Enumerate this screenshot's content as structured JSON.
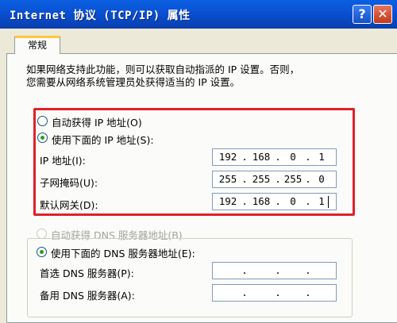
{
  "window": {
    "title": "Internet 协议 (TCP/IP) 属性",
    "help_glyph": "?",
    "close_glyph": "✕"
  },
  "tab": {
    "label": "常规"
  },
  "description": {
    "line1": "如果网络支持此功能，则可以获取自动指派的 IP 设置。否则，",
    "line2": "您需要从网络系统管理员处获得适当的 IP 设置。"
  },
  "ip_section": {
    "auto_option": "自动获得 IP 地址(O)",
    "manual_option": "使用下面的 IP 地址(S):",
    "selected": "manual",
    "fields": [
      {
        "label": "IP 地址(I):",
        "octets": [
          "192",
          "168",
          "0",
          "1"
        ]
      },
      {
        "label": "子网掩码(U):",
        "octets": [
          "255",
          "255",
          "255",
          "0"
        ]
      },
      {
        "label": "默认网关(D):",
        "octets": [
          "192",
          "168",
          "0",
          "1"
        ]
      }
    ]
  },
  "dns_section": {
    "auto_option": "自动获得 DNS 服务器地址(B)",
    "manual_option": "使用下面的 DNS 服务器地址(E):",
    "selected": "manual",
    "fields": [
      {
        "label": "首选 DNS 服务器(P):",
        "octets": [
          "",
          "",
          "",
          ""
        ]
      },
      {
        "label": "备用 DNS 服务器(A):",
        "octets": [
          "",
          "",
          "",
          ""
        ]
      }
    ]
  },
  "dot": ".",
  "colors": {
    "titlebar": "#0a54d6",
    "highlight_border": "#e0202a",
    "tab_accent": "#ffc83c"
  }
}
